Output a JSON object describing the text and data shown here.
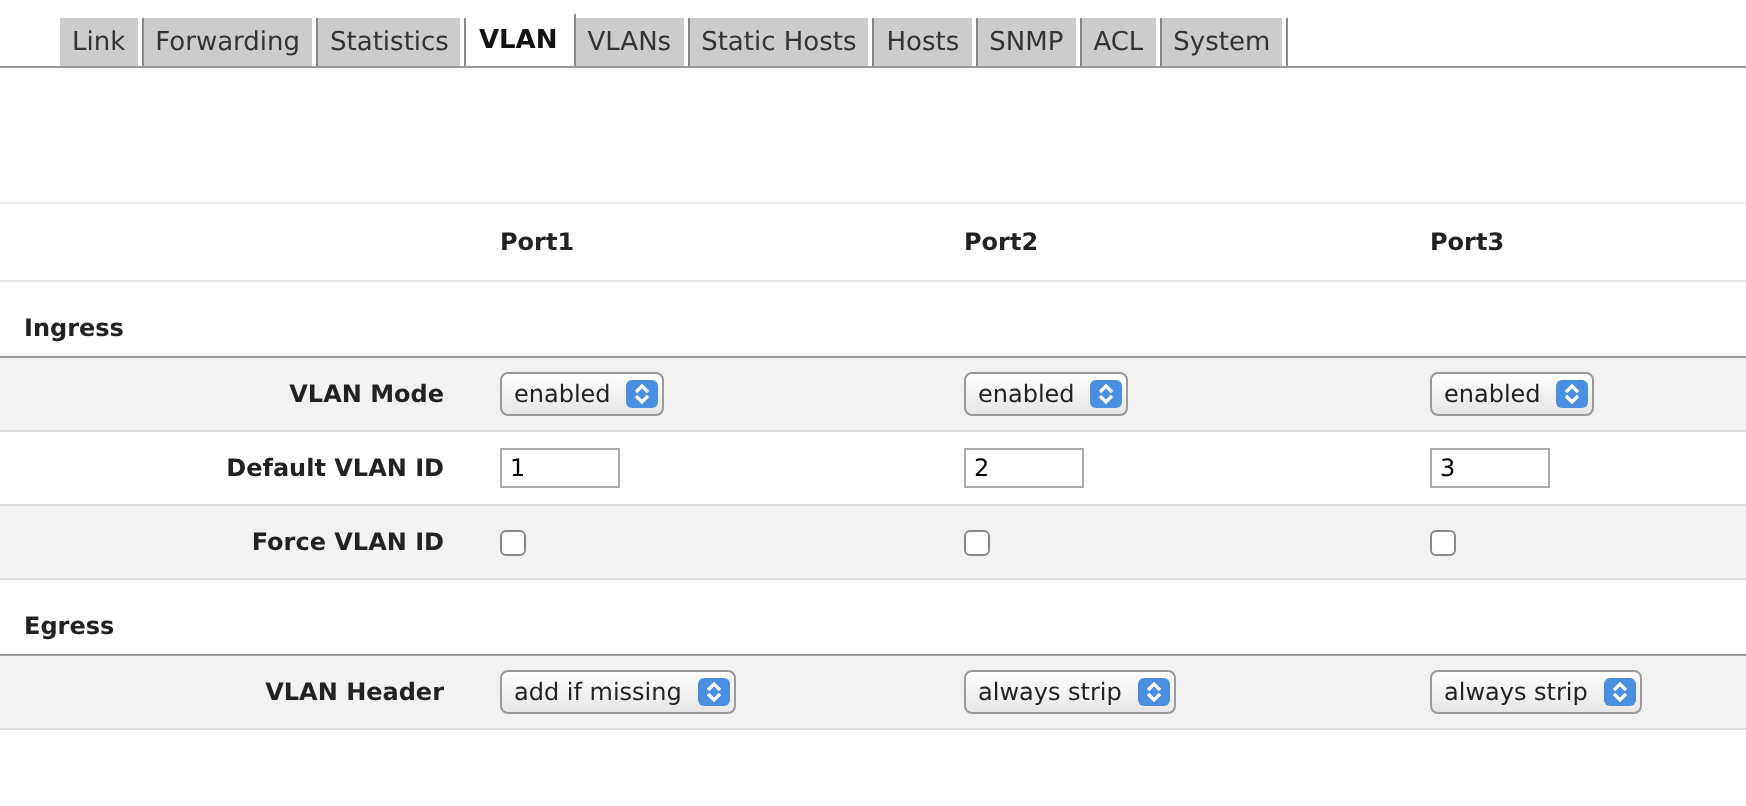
{
  "tabs": [
    {
      "label": "Link",
      "selected": false
    },
    {
      "label": "Forwarding",
      "selected": false
    },
    {
      "label": "Statistics",
      "selected": false
    },
    {
      "label": "VLAN",
      "selected": true
    },
    {
      "label": "VLANs",
      "selected": false
    },
    {
      "label": "Static Hosts",
      "selected": false
    },
    {
      "label": "Hosts",
      "selected": false
    },
    {
      "label": "SNMP",
      "selected": false
    },
    {
      "label": "ACL",
      "selected": false
    },
    {
      "label": "System",
      "selected": false
    }
  ],
  "columns": [
    "Port1",
    "Port2",
    "Port3"
  ],
  "sections": [
    {
      "title": "Ingress",
      "rows": [
        {
          "label": "VLAN Mode",
          "kind": "select",
          "cells": [
            {
              "value": "enabled"
            },
            {
              "value": "enabled"
            },
            {
              "value": "enabled"
            }
          ]
        },
        {
          "label": "Default VLAN ID",
          "kind": "text",
          "cells": [
            {
              "value": "1"
            },
            {
              "value": "2"
            },
            {
              "value": "3"
            }
          ]
        },
        {
          "label": "Force VLAN ID",
          "kind": "checkbox",
          "cells": [
            {
              "checked": false
            },
            {
              "checked": false
            },
            {
              "checked": false
            }
          ]
        }
      ]
    },
    {
      "title": "Egress",
      "rows": [
        {
          "label": "VLAN Header",
          "kind": "select",
          "cells": [
            {
              "value": "add if missing"
            },
            {
              "value": "always strip"
            },
            {
              "value": "always strip"
            }
          ]
        }
      ]
    }
  ]
}
